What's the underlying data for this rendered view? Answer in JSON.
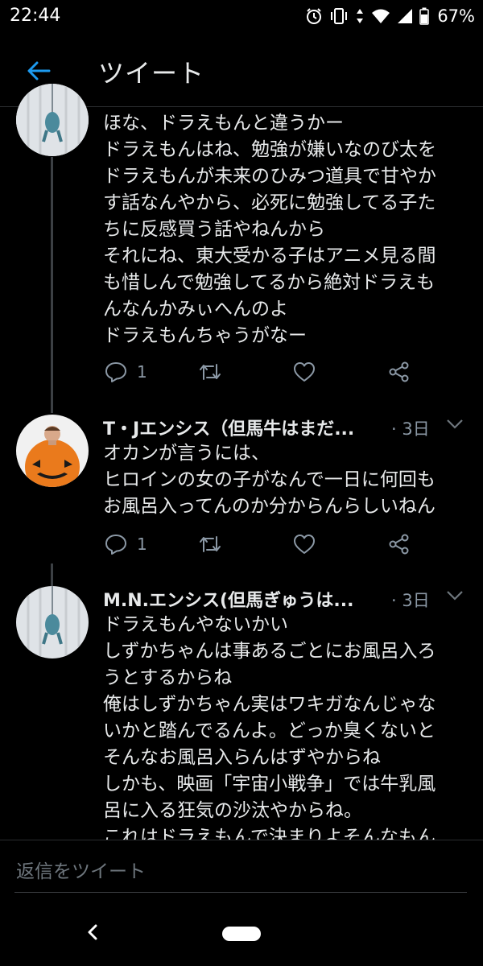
{
  "status_bar": {
    "time": "22:44",
    "battery": "67%"
  },
  "header": {
    "title": "ツイート"
  },
  "tweets": [
    {
      "text": "ほな、ドラえもんと違うかー\nドラえもんはね、勉強が嫌いなのび太を\nドラえもんが未来のひみつ道具で甘やか\nす話なんやから、必死に勉強してる子た\nちに反感買う話やねんから\nそれにね、東大受かる子はアニメ見る間\nも惜しんで勉強してるから絶対ドラえも\nんなんかみぃへんのよ\nドラえもんちゃうがなー",
      "reply_count": "1"
    },
    {
      "name": "T・Jエンシス（但馬牛はまだ...",
      "time": "· 3日",
      "text": "オカンが言うには、\nヒロインの女の子がなんで一日に何回も\nお風呂入ってんのか分からんらしいねん",
      "reply_count": "1"
    },
    {
      "name": "M.N.エンシス(但馬ぎゅうは...",
      "time": "· 3日",
      "text": "ドラえもんやないかい\nしずかちゃんは事あるごとにお風呂入ろ\nうとするからね\n俺はしずかちゃん実はワキガなんじゃな\nいかと踏んでるんよ。どっか臭くないと\nそんなお風呂入らんはずやからね\nしかも、映画「宇宙小戦争」では牛乳風\n呂に入る狂気の沙汰やからね。\nこれはドラえもんで決まりよそんなもん"
    }
  ],
  "reply_bar": {
    "placeholder": "返信をツイート"
  },
  "colors": {
    "accent": "#1d9bf0",
    "muted": "#8b98a5",
    "background": "#000000",
    "text": "#e7e9ea"
  },
  "icons": [
    "back-arrow-icon",
    "reply-icon",
    "retweet-icon",
    "like-icon",
    "share-icon",
    "chevron-down-icon",
    "alarm-icon",
    "vibrate-icon",
    "data-arrows-icon",
    "wifi-icon",
    "signal-icon",
    "battery-icon"
  ]
}
